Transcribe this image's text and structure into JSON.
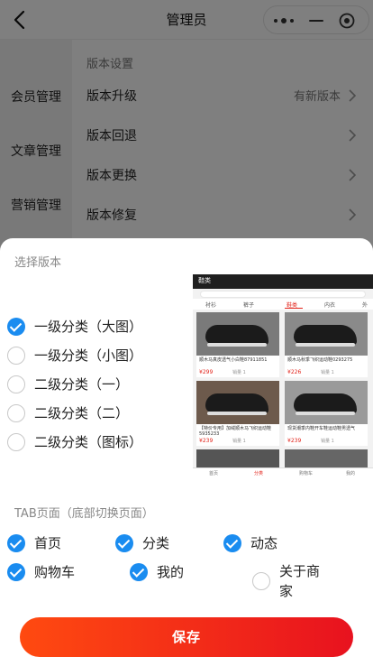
{
  "header": {
    "title": "管理员"
  },
  "sidebar": {
    "items": [
      {
        "label": "会员管理"
      },
      {
        "label": "文章管理"
      },
      {
        "label": "营销管理"
      }
    ]
  },
  "settings": {
    "section_title": "版本设置",
    "rows": [
      {
        "label": "版本升级",
        "value": "有新版本"
      },
      {
        "label": "版本回退"
      },
      {
        "label": "版本更换"
      },
      {
        "label": "版本修复"
      }
    ]
  },
  "sheet": {
    "version_title": "选择版本",
    "versions": [
      {
        "label": "一级分类（大图）",
        "checked": true
      },
      {
        "label": "一级分类（小图）",
        "checked": false
      },
      {
        "label": "二级分类（一）",
        "checked": false
      },
      {
        "label": "二级分类（二）",
        "checked": false
      },
      {
        "label": "二级分类（图标）",
        "checked": false
      }
    ],
    "tab_title": "TAB页面（底部切换页面）",
    "tabs": [
      {
        "label": "首页",
        "checked": true
      },
      {
        "label": "分类",
        "checked": true
      },
      {
        "label": "动态",
        "checked": true
      },
      {
        "label": "购物车",
        "checked": true
      },
      {
        "label": "我的",
        "checked": true
      },
      {
        "label": "关于商家",
        "checked": false
      }
    ],
    "save_label": "保存"
  },
  "preview": {
    "title": "鞋类",
    "tabs": [
      "衬衫",
      "裤子",
      "鞋类",
      "内衣",
      "外"
    ],
    "products": [
      {
        "name": "顺木马真皮透气小白鞋87911851",
        "price": "¥299",
        "sales": "销量 1"
      },
      {
        "name": "顺木马秋季飞织运动鞋0293275",
        "price": "¥226",
        "sales": "销量 1"
      },
      {
        "name": "【特价专用】加绒顺木马飞织运动鞋 5935233",
        "price": "¥239",
        "sales": "销量 1"
      },
      {
        "name": "现货潮季内鞋开车鞋运动鞋男透气",
        "price": "¥239",
        "sales": "销量 1"
      }
    ],
    "bottom_tabs": [
      "首页",
      "分类",
      "购物车",
      "我的"
    ]
  },
  "colors": {
    "accent_blue": "#1a8cf0",
    "save_gradient_start": "#ff4a10",
    "save_gradient_end": "#e8121f",
    "price_red": "#e2231a"
  }
}
